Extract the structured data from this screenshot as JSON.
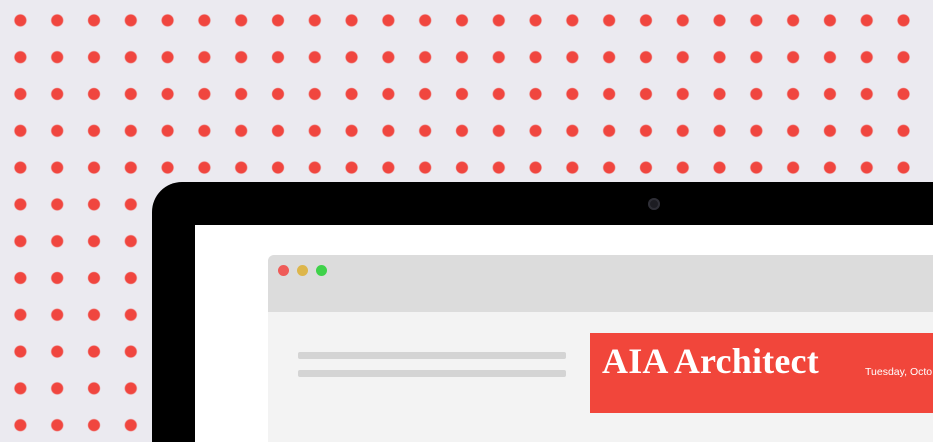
{
  "publication": {
    "title": "AIA Architect",
    "date": "Tuesday, Octo"
  },
  "colors": {
    "accent_red": "#f1463b",
    "background": "#ebeaf0",
    "monitor_bezel": "#000000",
    "toolbar": "#dcdcdc"
  },
  "icons": {
    "close": "window-close-icon",
    "minimize": "window-minimize-icon",
    "maximize": "window-maximize-icon",
    "camera": "webcam-icon"
  }
}
